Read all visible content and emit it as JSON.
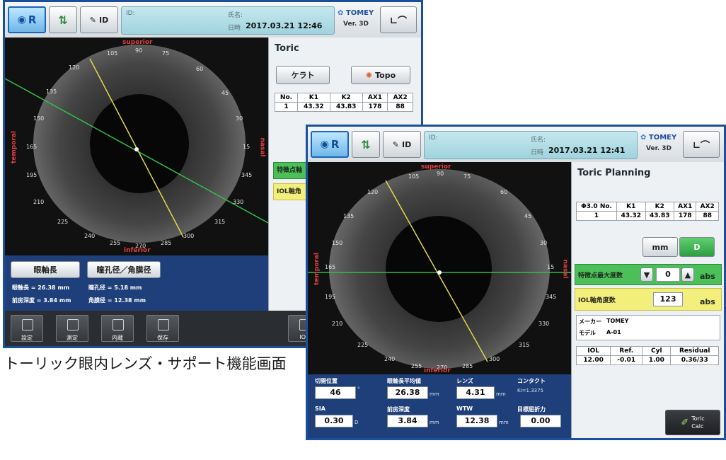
{
  "caption": "トーリック眼内レンズ・サポート機能画面",
  "common": {
    "eye_button": "R",
    "id_button": "ID",
    "id_label": "ID:",
    "name_label": "氏名:",
    "brand": "TOMEY",
    "version": "Ver. 3D"
  },
  "eye_image": {
    "degree_labels": [
      "105",
      "90",
      "75",
      "120",
      "60",
      "135",
      "45",
      "150",
      "30",
      "165",
      "15",
      "195",
      "345",
      "210",
      "330",
      "225",
      "315",
      "240",
      "300",
      "255",
      "270",
      "285"
    ],
    "superior": "superior",
    "inferior": "inferior",
    "temporal": "temporal",
    "nasal": "nasal"
  },
  "back_screen": {
    "date_prefix": "日時",
    "datetime": "2017.03.21  12:46",
    "panel_title": "Toric",
    "kerato_button": "ケラト",
    "topo_button": "Topo",
    "k_table": {
      "headers": [
        "No.",
        "K1",
        "K2",
        "AX1",
        "AX2"
      ],
      "rows": [
        [
          "1",
          "43.32",
          "43.83",
          "178",
          "88"
        ]
      ]
    },
    "green_bar_label": "特徴点軸",
    "yellow_bar_label": "IOL軸角",
    "eye_axial_button": "眼軸長",
    "pupil_button": "瞳孔径／角膜径",
    "axial_length": "眼軸長 = 26.38 mm",
    "acd": "前房深度 = 3.84 mm",
    "pupil_diameter": "瞳孔径 = 5.18 mm",
    "corneal_diameter": "角膜径 = 12.38 mm",
    "toolbar": [
      "設定",
      "測定",
      "内蔵",
      "保存",
      "IOL"
    ]
  },
  "front_screen": {
    "date_prefix": "日時",
    "datetime": "2017.03.21  12:41",
    "panel_title": "Toric Planning",
    "k_table": {
      "headers": [
        "Φ3.0 No.",
        "K1",
        "K2",
        "AX1",
        "AX2"
      ],
      "rows": [
        [
          "1",
          "43.32",
          "43.83",
          "178",
          "88"
        ]
      ]
    },
    "mm_button": "mm",
    "d_button": "D",
    "green_bar_label": "特徴点最大度数",
    "green_value": "0",
    "yellow_bar_label": "IOL軸角度数",
    "yellow_value": "123",
    "abs": "abs",
    "maker_label": "メーカー",
    "maker_value": "TOMEY",
    "model_label": "モデル",
    "model_value": "A-01",
    "iol_table": {
      "headers": [
        "IOL",
        "Ref.",
        "Cyl",
        "Residual"
      ],
      "rows": [
        [
          "12.00",
          "-0.01",
          "1.00",
          "0.36/33"
        ]
      ]
    },
    "toric_calc_line1": "Toric",
    "toric_calc_line2": "Calc",
    "bottom": {
      "incision_label": "切開位置",
      "incision_value": "46",
      "incision_unit": "°",
      "axial_avg_label": "眼軸長平均値",
      "axial_avg_value": "26.38",
      "axial_avg_unit": "mm",
      "lens_label": "レンズ",
      "lens_value": "4.31",
      "lens_unit": "mm",
      "contact_label": "コンタクト",
      "contact_index": "KI=1.3375",
      "sia_label": "SIA",
      "sia_value": "0.30",
      "sia_unit": "D",
      "acd_label": "前房深度",
      "acd_value": "3.84",
      "acd_unit": "mm",
      "wtw_label": "WTW",
      "wtw_value": "12.38",
      "wtw_unit": "mm",
      "target_label": "目標屈折力",
      "target_value": "0.00"
    }
  },
  "colors": {
    "frame": "#1b4f9c",
    "green_axis": "#2fbf4a",
    "yellow_axis": "#e0d94a",
    "accent_red": "#e04040"
  }
}
